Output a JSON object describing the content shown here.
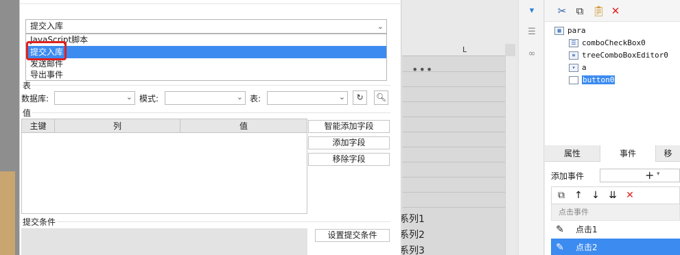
{
  "dialog": {
    "commit_type": {
      "value": "提交入库",
      "options": [
        "JavaScript脚本",
        "提交入库",
        "发送邮件",
        "导出事件"
      ],
      "selected_index": 1
    },
    "table_section": {
      "title": "表",
      "database_label": "数据库:",
      "mode_label": "模式:",
      "table_label": "表:"
    },
    "value_section": {
      "title": "值",
      "columns": [
        "主键",
        "列",
        "值"
      ],
      "buttons": [
        "智能添加字段",
        "添加字段",
        "移除字段"
      ]
    },
    "condition_section": {
      "title": "提交条件",
      "set_button": "设置提交条件"
    }
  },
  "sheet": {
    "column_letter": "L",
    "more": "•••",
    "series": [
      "系列1",
      "系列2",
      "系列3"
    ]
  },
  "right_panel": {
    "tree": {
      "root": "para",
      "children": [
        "comboCheckBox0",
        "treeComboBoxEditor0",
        "a",
        "button0"
      ],
      "selected": "button0"
    },
    "tabs": [
      "属性",
      "事件",
      "移"
    ],
    "active_tab": "事件",
    "add_event_label": "添加事件",
    "add_event_plus": "+",
    "event_list_header": "点击事件",
    "events": [
      "点击1",
      "点击2"
    ],
    "selected_event": "点击2"
  },
  "colors": {
    "selection_blue": "#3c8bf0",
    "highlight_red": "#e02020",
    "delete_red": "#e02020"
  },
  "icons": {
    "toolbar": [
      "cut-icon",
      "copy-icon",
      "paste-icon",
      "delete-icon"
    ],
    "event_toolbar": [
      "copy-icon",
      "arrow-up-icon",
      "arrow-down-icon",
      "move-bottom-icon",
      "delete-icon"
    ]
  }
}
